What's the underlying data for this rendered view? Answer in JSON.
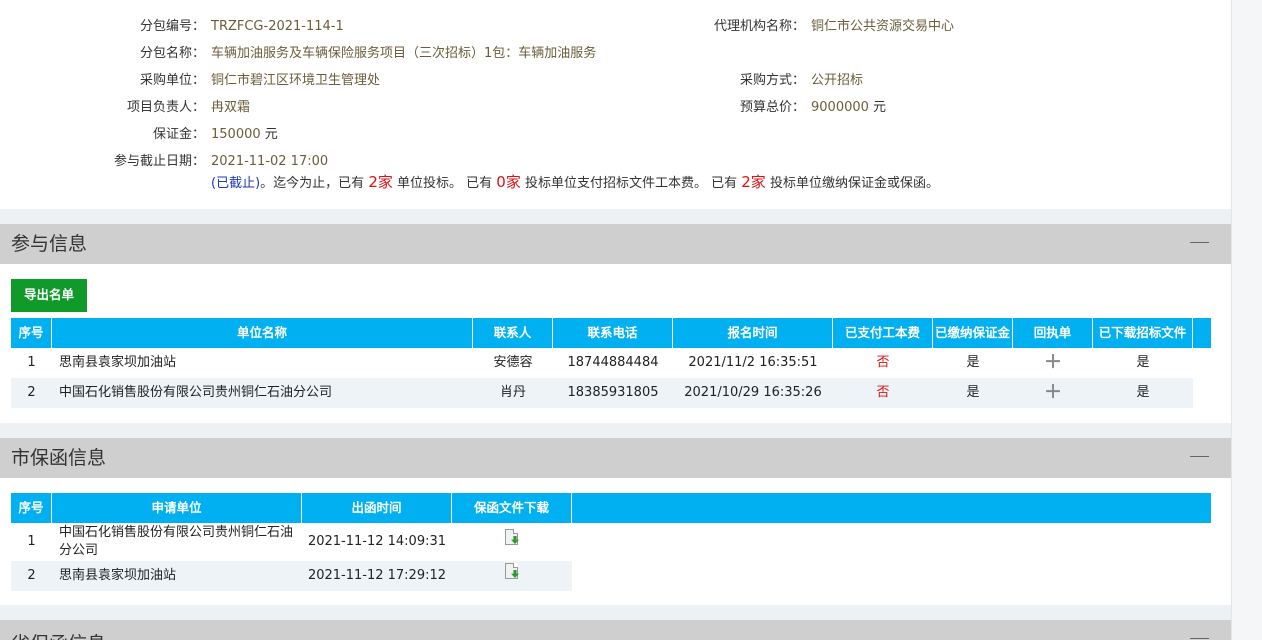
{
  "info": {
    "package_no_label": "分包编号：",
    "package_no": "TRZFCG-2021-114-1",
    "agency_label": "代理机构名称：",
    "agency": "铜仁市公共资源交易中心",
    "package_name_label": "分包名称：",
    "package_name": "车辆加油服务及车辆保险服务项目（三次招标）1包：车辆加油服务",
    "buyer_label": "采购单位：",
    "buyer": "铜仁市碧江区环境卫生管理处",
    "method_label": "采购方式：",
    "method": "公开招标",
    "manager_label": "项目负责人：",
    "manager": "冉双霜",
    "budget_label": "预算总价：",
    "budget": "9000000",
    "budget_unit": "元",
    "deposit_label": "保证金：",
    "deposit": "150000",
    "deposit_unit": "元",
    "deadline_label": "参与截止日期：",
    "deadline": "2021-11-02 17:00",
    "status": "(已截止)",
    "summary_1": "。迄今为止，已有",
    "count_bid": "2家",
    "summary_2": "单位投标。 已有",
    "count_paid": "0家",
    "summary_3": "投标单位支付招标文件工本费。 已有",
    "count_deposit": "2家",
    "summary_4": "投标单位缴纳保证金或保函。"
  },
  "participation": {
    "title": "参与信息",
    "export_label": "导出名单",
    "headers": [
      "序号",
      "单位名称",
      "联系人",
      "联系电话",
      "报名时间",
      "已支付工本费",
      "已缴纳保证金",
      "回执单",
      "已下载招标文件"
    ],
    "rows": [
      [
        "1",
        "思南县袁家坝加油站",
        "安德容",
        "18744884484",
        "2021/11/2 16:35:51",
        "否",
        "是",
        "＋",
        "是"
      ],
      [
        "2",
        "中国石化销售股份有限公司贵州铜仁石油分公司",
        "肖丹",
        "18385931805",
        "2021/10/29 16:35:26",
        "否",
        "是",
        "＋",
        "是"
      ]
    ]
  },
  "city_guarantee": {
    "title": "市保函信息",
    "headers": [
      "序号",
      "申请单位",
      "出函时间",
      "保函文件下载"
    ],
    "rows": [
      [
        "1",
        "中国石化销售股份有限公司贵州铜仁石油分公司",
        "2021-11-12 14:09:31"
      ],
      [
        "2",
        "思南县袁家坝加油站",
        "2021-11-12 17:29:12"
      ]
    ]
  },
  "province_guarantee": {
    "title": "省保函信息"
  },
  "colors": {
    "header_blue": "#00b0f0",
    "export_green": "#109a2a",
    "highlight_red": "#dd1111",
    "status_blue": "#1e3ab8"
  },
  "icons": {
    "collapse": "minus-icon",
    "receipt": "plus-icon",
    "download": "file-download-icon"
  }
}
